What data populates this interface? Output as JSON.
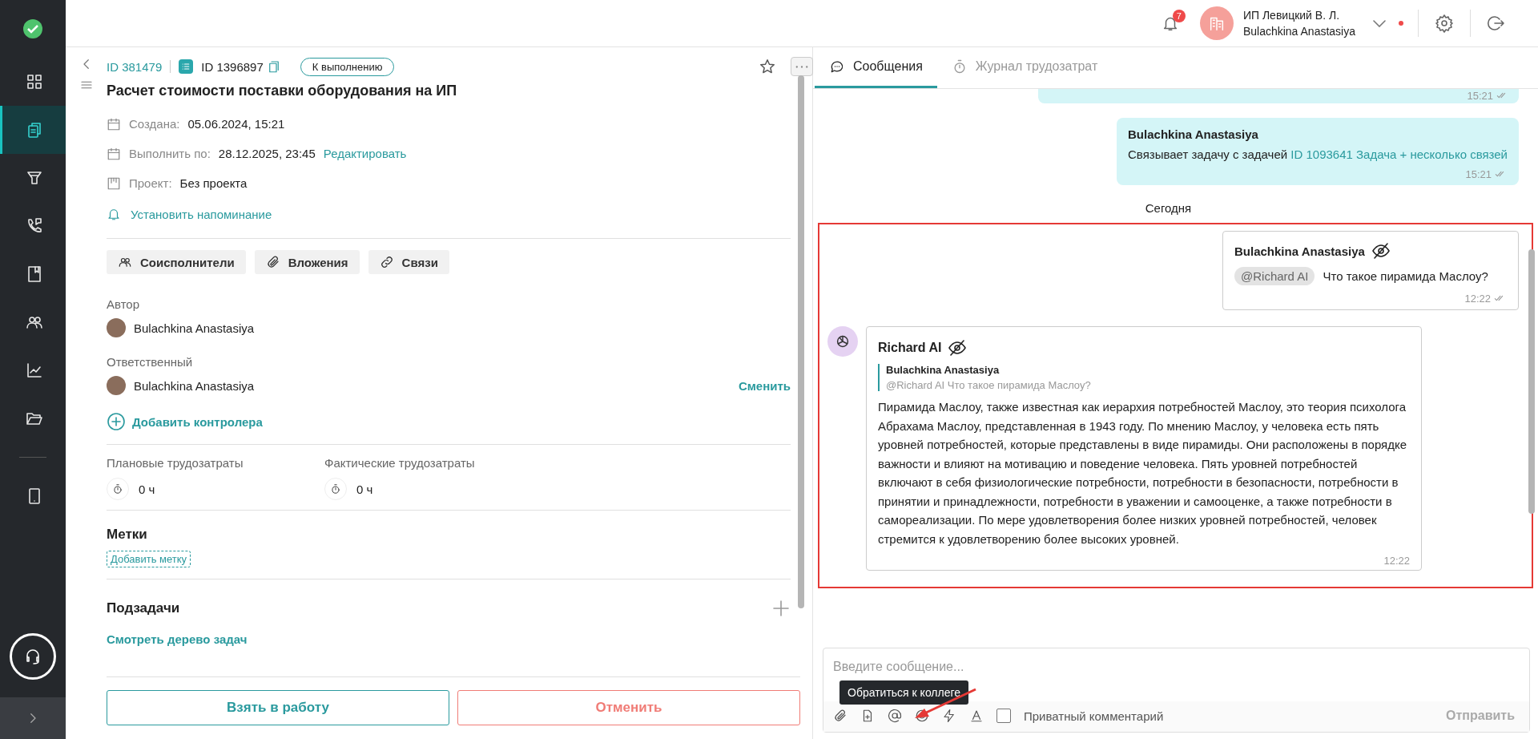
{
  "sidebar": {
    "nav": [
      {
        "kind": "grid",
        "selected": false
      },
      {
        "kind": "tasks",
        "selected": true
      },
      {
        "kind": "funnel",
        "selected": false
      },
      {
        "kind": "phone",
        "selected": false
      },
      {
        "kind": "book",
        "selected": false
      },
      {
        "kind": "people",
        "selected": false
      },
      {
        "kind": "chart",
        "selected": false
      },
      {
        "kind": "folder",
        "selected": false
      },
      {
        "kind": "tablet",
        "selected": false
      }
    ]
  },
  "header": {
    "notifications": "7",
    "company": "ИП Левицкий В. Л.",
    "user": "Bulachkina Anastasiya"
  },
  "task": {
    "parent_id": "ID 381479",
    "id": "ID 1396897",
    "status": "К выполнению",
    "title": "Расчет стоимости поставки оборудования на ИП",
    "fields": [
      {
        "kind": "calendar",
        "label": "Создана:",
        "value": "05.06.2024, 15:21"
      },
      {
        "kind": "calendar",
        "label": "Выполнить по:",
        "value": "28.12.2025, 23:45",
        "link": "Редактировать"
      },
      {
        "kind": "board",
        "label": "Проект:",
        "value": "Без проекта"
      }
    ],
    "reminder": "Установить напоминание",
    "buttons": [
      {
        "kind": "people",
        "label": "Соисполнители"
      },
      {
        "kind": "clip",
        "label": "Вложения"
      },
      {
        "kind": "link",
        "label": "Связи"
      }
    ],
    "author": {
      "label": "Автор",
      "name": "Bulachkina Anastasiya"
    },
    "responsible": {
      "label": "Ответственный",
      "name": "Bulachkina Anastasiya",
      "change": "Сменить"
    },
    "add_controller": "Добавить контролера",
    "efforts": [
      {
        "label": "Плановые трудозатраты",
        "value": "0 ч"
      },
      {
        "label": "Фактические трудозатраты",
        "value": "0 ч"
      }
    ],
    "tags": {
      "heading": "Метки",
      "add": "Добавить метку"
    },
    "subtasks": {
      "heading": "Подзадачи",
      "tree": "Смотреть дерево задач"
    },
    "actions": {
      "take": "Взять в работу",
      "cancel": "Отменить"
    }
  },
  "chat": {
    "tabs": [
      {
        "kind": "chat",
        "label": "Сообщения",
        "selected": true
      },
      {
        "kind": "timer",
        "label": "Журнал трудозатрат",
        "selected": false
      }
    ],
    "earlier": [
      {
        "kind": "cut",
        "time": "15:21"
      },
      {
        "kind": "full",
        "author": "Bulachkina Anastasiya",
        "text": "Связывает задачу с задачей",
        "link": "ID 1093641 Задача + несколько связей",
        "time": "15:21"
      }
    ],
    "date": "Сегодня",
    "question": {
      "author": "Bulachkina Anastasiya",
      "mention": "@Richard AI",
      "text": "Что такое пирамида Маслоу?",
      "time": "12:22"
    },
    "answer": {
      "author": "Richard AI",
      "quote_author": "Bulachkina Anastasiya",
      "quote_text": "@Richard AI Что такое пирамида Маслоу?",
      "text": "Пирамида Маслоу, также известная как иерархия потребностей Маслоу, это теория психолога Абрахама Маслоу, представленная в 1943 году. По мнению Маслоу, у человека есть пять уровней потребностей, которые представлены в виде пирамиды. Они расположены в порядке важности и влияют на мотивацию и поведение человека. Пять уровней потребностей включают в себя физиологические потребности, потребности в безопасности, потребности в принятии и принадлежности, потребности в уважении и самооценке, а также потребности в самореализации. По мере удовлетворения более низких уровней потребностей, человек стремится к удовлетворению более высоких уровней.",
      "time": "12:22"
    },
    "composer": {
      "placeholder": "Введите сообщение...",
      "tooltip": "Обратиться к коллеге",
      "private": {
        "label": "Приватный комментарий",
        "checked": false
      },
      "send": "Отправить"
    }
  }
}
